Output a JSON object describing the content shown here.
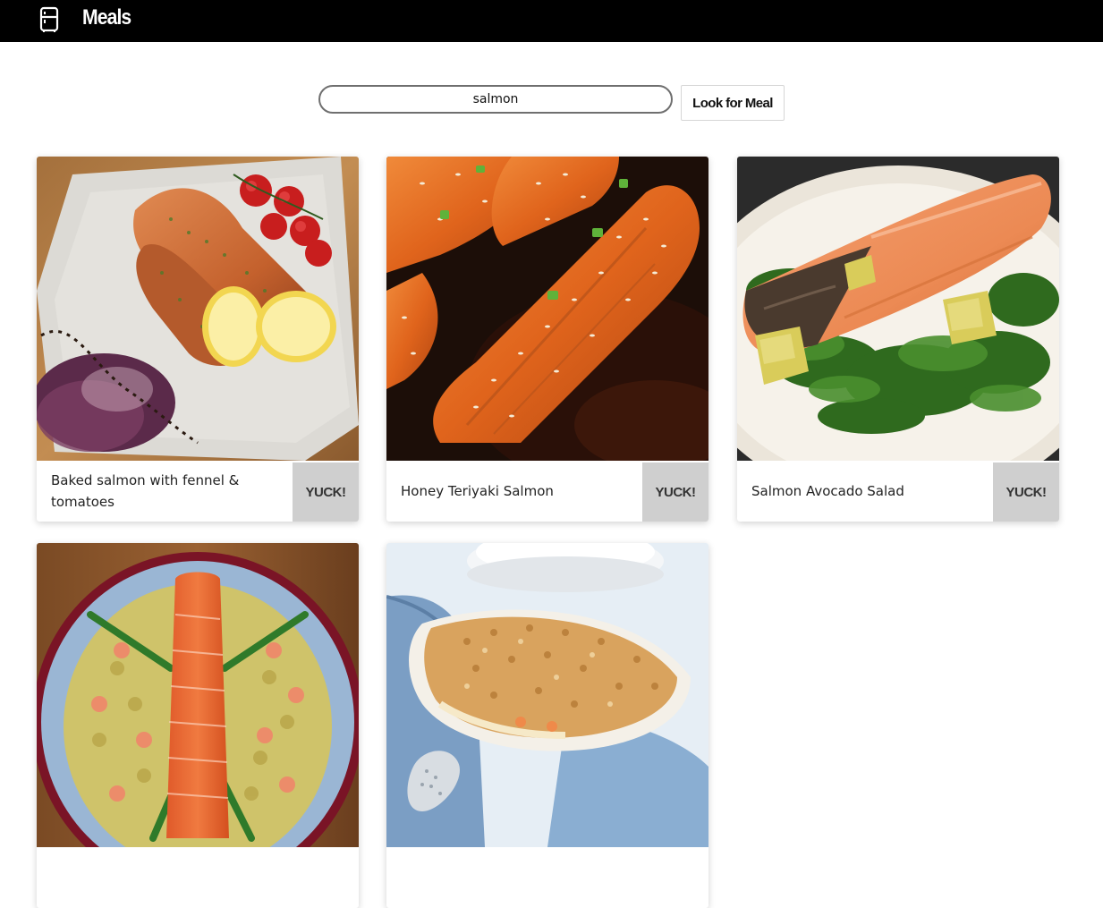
{
  "header": {
    "brand": "Meals",
    "icon": "fridge-icon",
    "background": "#000000"
  },
  "search": {
    "value": "salmon",
    "placeholder": "",
    "button_label": "Look for Meal"
  },
  "meals": [
    {
      "title": "Baked salmon with fennel & tomatoes",
      "action_label": "YUCK!"
    },
    {
      "title": "Honey Teriyaki Salmon",
      "action_label": "YUCK!"
    },
    {
      "title": "Salmon Avocado Salad",
      "action_label": "YUCK!"
    },
    {
      "title": "",
      "action_label": ""
    },
    {
      "title": "",
      "action_label": ""
    }
  ],
  "colors": {
    "action_button_bg": "#cfcfcf",
    "search_border": "#6f6f6f"
  }
}
